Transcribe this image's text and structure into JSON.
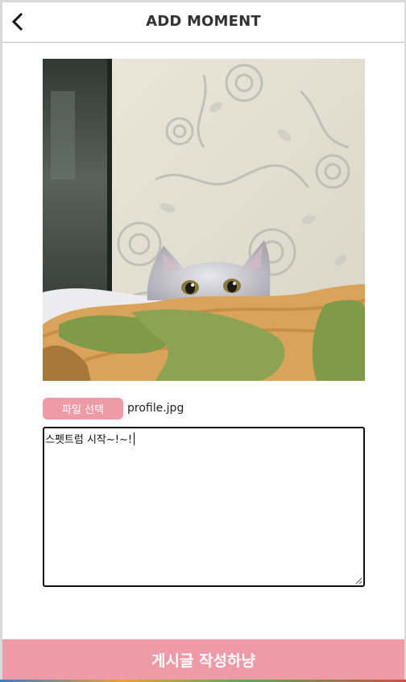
{
  "header": {
    "title": "ADD MOMENT",
    "back_icon": "chevron-left-icon"
  },
  "photo": {
    "subject": "cat-photo"
  },
  "file_input": {
    "button_label": "파일 선택",
    "file_name": "profile.jpg"
  },
  "content_input": {
    "value": "스펫트럼 시작~!~!"
  },
  "submit": {
    "label": "게시글 작성하냥"
  },
  "colors": {
    "accent": "#ee9ba7",
    "header_border": "#bdbdbd",
    "text": "#333333"
  }
}
